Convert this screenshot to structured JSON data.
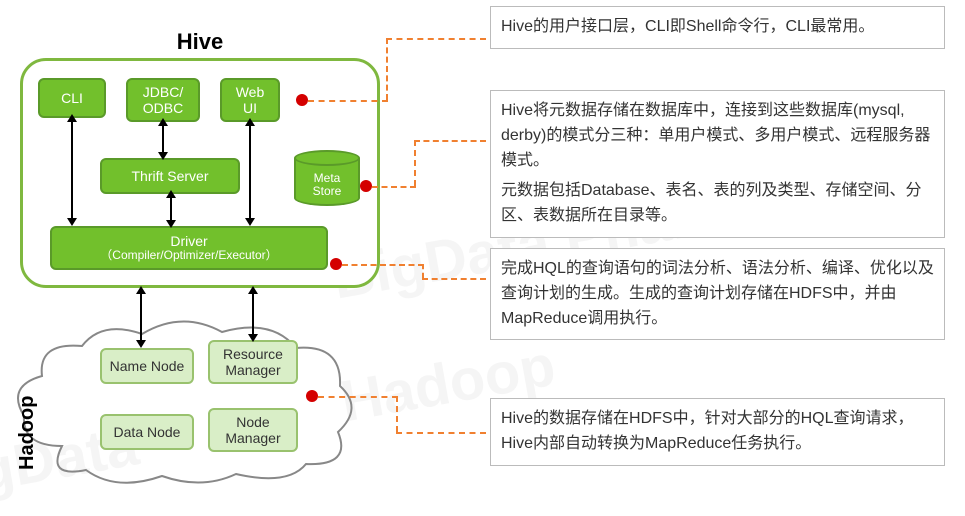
{
  "watermarks": {
    "w1": "BigData Pharm",
    "w2": "Hadoop",
    "w3": "BigData"
  },
  "hive": {
    "title": "Hive",
    "cli": "CLI",
    "jdbc": "JDBC/\nODBC",
    "webui": "Web\nUI",
    "thrift": "Thrift Server",
    "driver_title": "Driver",
    "driver_sub": "（Compiler/Optimizer/Executor）",
    "meta": "Meta\nStore"
  },
  "hadoop": {
    "label": "Hadoop",
    "nn": "Name Node",
    "rm": "Resource\nManager",
    "dn": "Data Node",
    "nm": "Node\nManager"
  },
  "notes": {
    "n1": "Hive的用户接口层，CLI即Shell命令行，CLI最常用。",
    "n2a": "Hive将元数据存储在数据库中，连接到这些数据库(mysql, derby)的模式分三种：单用户模式、多用户模式、远程服务器模式。",
    "n2b": "元数据包括Database、表名、表的列及类型、存储空间、分区、表数据所在目录等。",
    "n3": "完成HQL的查询语句的词法分析、语法分析、编译、优化以及查询计划的生成。生成的查询计划存储在HDFS中，并由MapReduce调用执行。",
    "n4": "Hive的数据存储在HDFS中，针对大部分的HQL查询请求，Hive内部自动转换为MapReduce任务执行。"
  }
}
